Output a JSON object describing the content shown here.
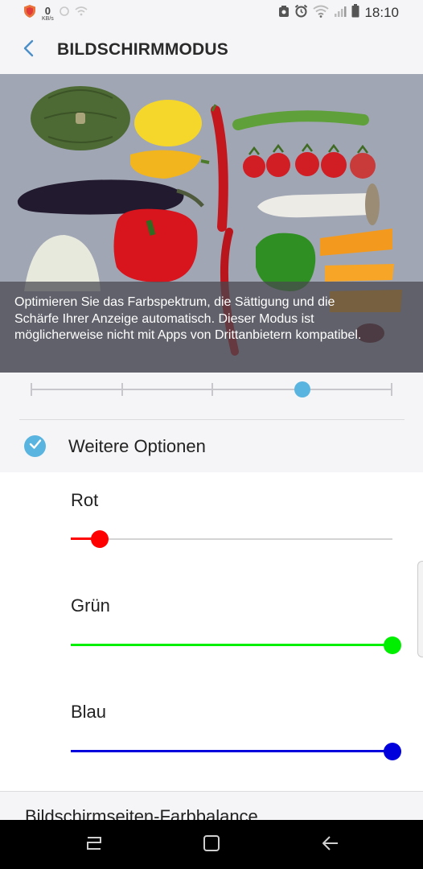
{
  "status_bar": {
    "net_speed_value": "0",
    "net_speed_unit": "KB/s",
    "time": "18:10",
    "icons": [
      "shield-icon",
      "sync-icon",
      "wifi-off-icon",
      "screenshot-icon",
      "alarm-clock-icon",
      "wifi-icon",
      "signal-icon",
      "battery-icon"
    ]
  },
  "header": {
    "title": "BILDSCHIRMMODUS",
    "back_icon": "chevron-left-icon"
  },
  "preview": {
    "caption": "Optimieren Sie das Farbspektrum, die Sättigung und die Schärfe Ihrer Anzeige automatisch. Dieser Modus ist möglicherweise nicht mit Apps von Drittanbietern kompatibel."
  },
  "mode_slider": {
    "steps": 5,
    "selected_index": 3
  },
  "options": {
    "label": "Weitere Optionen",
    "checked": true
  },
  "color_balance": {
    "red": {
      "label": "Rot",
      "value": 0.09,
      "color": "#ff0000"
    },
    "green": {
      "label": "Grün",
      "value": 1.0,
      "color": "#00ee00"
    },
    "blue": {
      "label": "Blau",
      "value": 1.0,
      "color": "#0000dd"
    }
  },
  "next_setting": {
    "label": "Bildschirmseiten-Farbbalance"
  },
  "nav_bar": {
    "buttons": [
      "recent-apps-icon",
      "home-icon",
      "back-icon"
    ]
  },
  "colors": {
    "accent": "#5ab4e0",
    "background": "#f5f5f7"
  }
}
